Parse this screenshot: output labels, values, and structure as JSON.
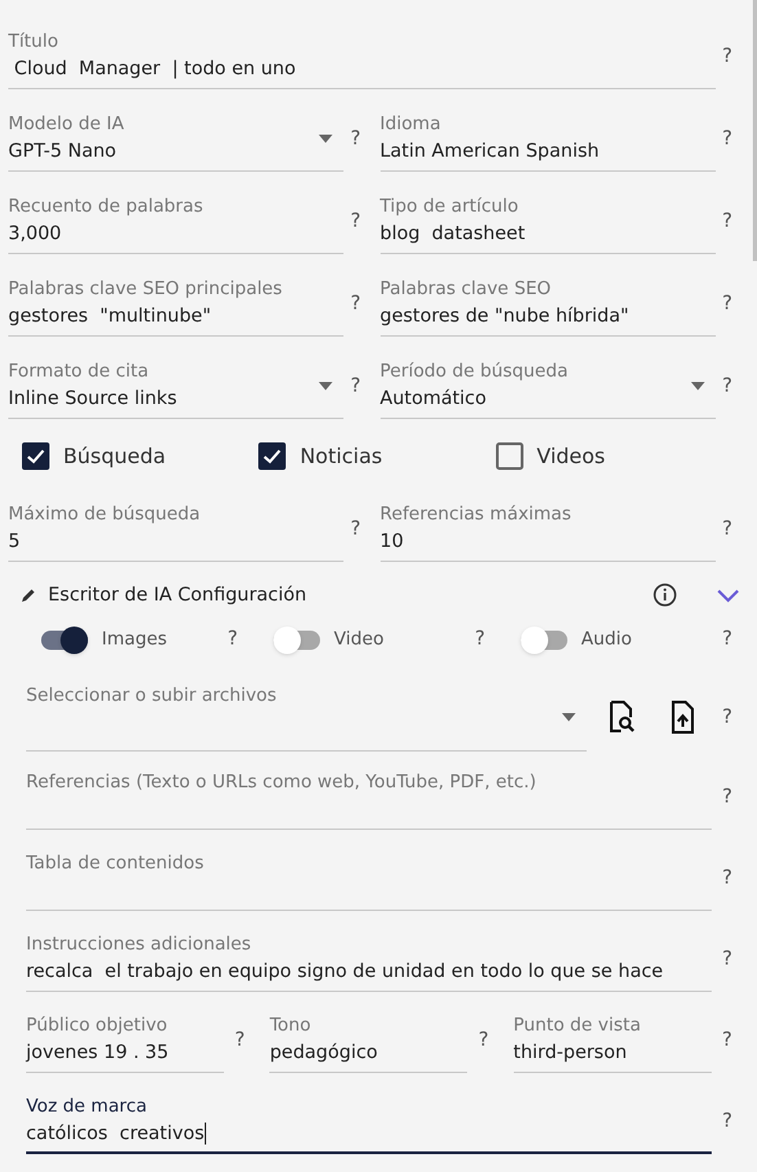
{
  "top_rows": [
    [
      {
        "kind": "text",
        "label": "Título",
        "value": " Cloud  Manager  | todo en uno",
        "focused": false,
        "help": "?"
      }
    ],
    [
      {
        "kind": "select",
        "label": "Modelo de IA",
        "value": "GPT-5 Nano",
        "focused": false,
        "help": "?"
      },
      {
        "kind": "text",
        "label": "Idioma",
        "value": "Latin American Spanish",
        "focused": false,
        "help": "?"
      }
    ],
    [
      {
        "kind": "text",
        "label": "Recuento de palabras",
        "value": "3,000",
        "focused": false,
        "help": "?"
      },
      {
        "kind": "text",
        "label": "Tipo de artículo",
        "value": "blog  datasheet",
        "focused": false,
        "help": "?"
      }
    ],
    [
      {
        "kind": "text",
        "label": "Palabras clave SEO principales",
        "value": "gestores  \"multinube\"",
        "focused": false,
        "help": "?"
      },
      {
        "kind": "text",
        "label": "Palabras clave SEO",
        "value": "gestores de \"nube híbrida\"",
        "focused": false,
        "help": "?"
      }
    ],
    [
      {
        "kind": "select",
        "label": "Formato de cita",
        "value": "Inline Source links",
        "focused": false,
        "help": "?"
      },
      {
        "kind": "select",
        "label": "Período de búsqueda",
        "value": "Automático",
        "focused": false,
        "help": "?"
      }
    ]
  ],
  "checkboxes": [
    {
      "label": "Búsqueda",
      "checked": true
    },
    {
      "label": "Noticias",
      "checked": true
    },
    {
      "label": "Videos",
      "checked": false
    }
  ],
  "limit_row": [
    {
      "kind": "text",
      "label": "Máximo de búsqueda",
      "value": "5",
      "focused": false,
      "help": "?"
    },
    {
      "kind": "text",
      "label": "Referencias máximas",
      "value": "10",
      "focused": false,
      "help": "?"
    }
  ],
  "section": {
    "title": "Escritor de IA Configuración",
    "expanded": true
  },
  "toggles": [
    {
      "label": "Images",
      "on": true,
      "help": "?"
    },
    {
      "label": "Video",
      "on": false,
      "help": "?"
    },
    {
      "label": "Audio",
      "on": false,
      "help": "?"
    }
  ],
  "files": {
    "label": "Seleccionar o subir archivos",
    "help": "?"
  },
  "bottom_rows": [
    [
      {
        "kind": "text",
        "label": "Referencias (Texto o URLs como web, YouTube, PDF, etc.)",
        "focused": false,
        "help": "?"
      }
    ],
    [
      {
        "kind": "text",
        "label": "Tabla de contenidos",
        "focused": false,
        "help": "?"
      }
    ],
    [
      {
        "kind": "text",
        "label": "Instrucciones adicionales",
        "value": "recalca  el trabajo en equipo signo de unidad en todo lo que se hace",
        "focused": false,
        "help": "?"
      }
    ],
    [
      {
        "kind": "text",
        "label": "Público objetivo",
        "value": "jovenes 19 . 35",
        "focused": false,
        "help": "?"
      },
      {
        "kind": "text",
        "label": "Tono",
        "value": "pedagógico",
        "focused": false,
        "help": "?"
      },
      {
        "kind": "text",
        "label": "Punto de vista",
        "value": "third-person",
        "focused": false,
        "help": "?"
      }
    ],
    [
      {
        "kind": "text",
        "label": "Voz de marca",
        "value": "católicos  creativos",
        "focused": true,
        "help": "?"
      }
    ]
  ]
}
